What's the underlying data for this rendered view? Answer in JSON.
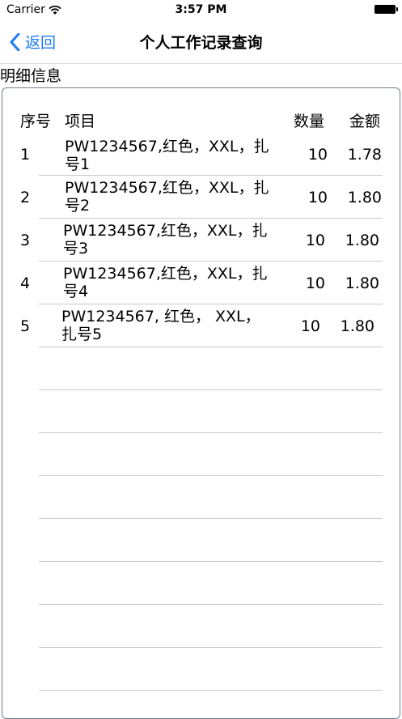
{
  "status_bar": {
    "carrier": "Carrier",
    "time": "3:57 PM"
  },
  "nav": {
    "back_label": "返回",
    "title": "个人工作记录查询"
  },
  "section": {
    "label": "明细信息"
  },
  "table": {
    "headers": {
      "index": "序号",
      "item": "项目",
      "quantity": "数量",
      "amount": "金额"
    },
    "rows": [
      {
        "index": "1",
        "item_line1": "PW1234567,红色，XXL，扎",
        "item_line2": "号1",
        "quantity": "10",
        "amount": "1.78"
      },
      {
        "index": "2",
        "item_line1": "PW1234567,红色，XXL，扎",
        "item_line2": "号2",
        "quantity": "10",
        "amount": "1.80"
      },
      {
        "index": "3",
        "item_line1": "PW1234567,红色，XXL，扎",
        "item_line2": "号3",
        "quantity": "10",
        "amount": "1.80"
      },
      {
        "index": "4",
        "item_line1": "PW1234567,红色，XXL，扎",
        "item_line2": "号4",
        "quantity": "10",
        "amount": "1.80"
      },
      {
        "index": "5",
        "item_line1": "PW1234567, 红色， XXL，",
        "item_line2": "扎号5",
        "quantity": "10",
        "amount": "1.80"
      }
    ]
  }
}
